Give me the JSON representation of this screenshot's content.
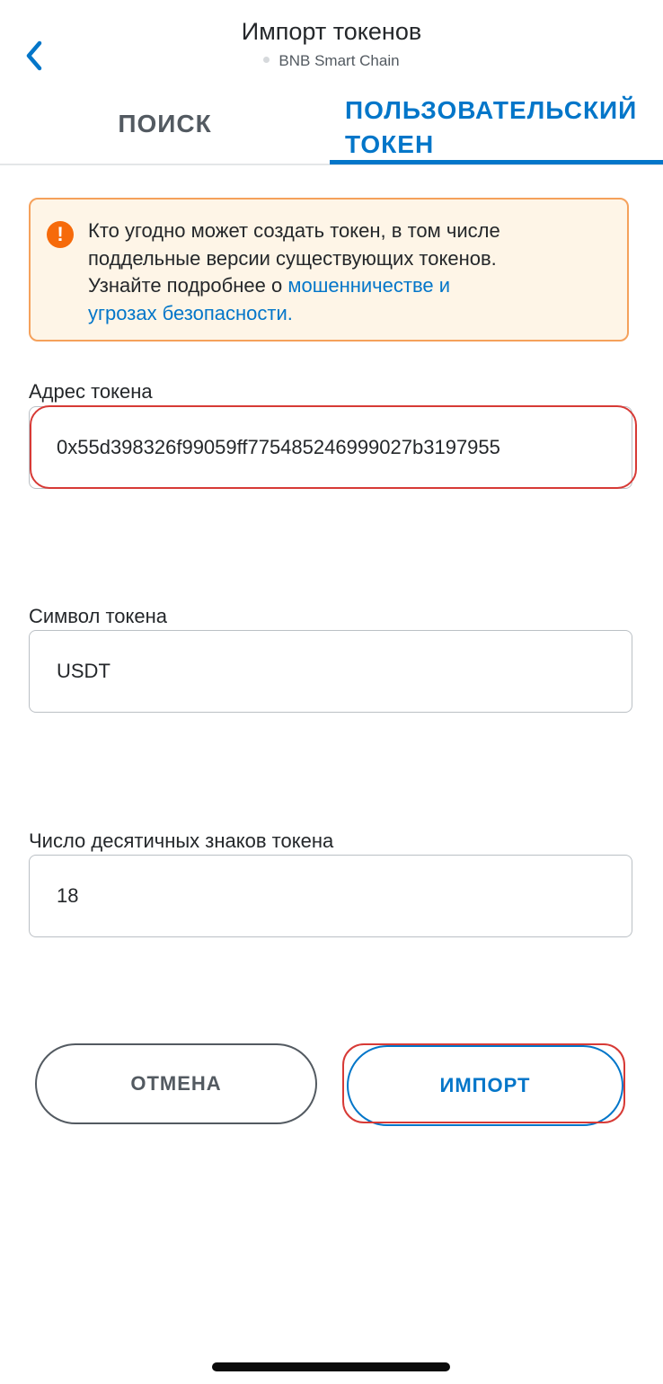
{
  "header": {
    "title": "Импорт токенов",
    "network": "BNB Smart Chain"
  },
  "tabs": [
    {
      "label": "ПОИСК",
      "active": false
    },
    {
      "label_line1": "ПОЛЬЗОВАТЕЛЬСКИЙ",
      "label_line2": "ТОКЕН",
      "active": true
    }
  ],
  "alert": {
    "icon": "exclamation-icon",
    "text_line1": "Кто угодно может создать токен, в том числе",
    "text_line2": "поддельные версии существующих токенов.",
    "text_line3_prefix": "Узнайте подробнее о ",
    "link_line3": "мошенничестве и",
    "link_line4": "угрозах безопасности."
  },
  "form": {
    "address": {
      "label": "Адрес токена",
      "value": "0x55d398326f99059ff775485246999027b3197955"
    },
    "symbol": {
      "label": "Символ токена",
      "value": "USDT"
    },
    "decimals": {
      "label": "Число десятичных знаков токена",
      "value": "18"
    }
  },
  "buttons": {
    "cancel": "ОТМЕНА",
    "import": "ИМПОРТ"
  },
  "colors": {
    "accent": "#0376c9",
    "warning_bg": "#fef5e7",
    "warning_border": "#f5a15b",
    "warning_icon": "#f66a0a",
    "highlight": "#d73a36"
  }
}
